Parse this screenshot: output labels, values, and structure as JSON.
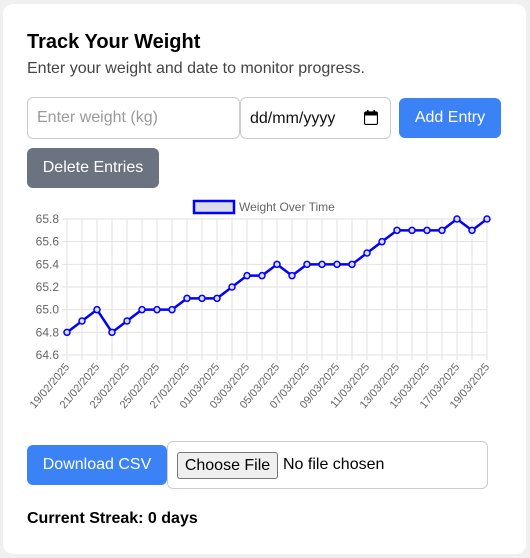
{
  "header": {
    "title": "Track Your Weight",
    "subtitle": "Enter your weight and date to monitor progress."
  },
  "form": {
    "weight_placeholder": "Enter weight (kg)",
    "date_placeholder": "dd/mm/yyyy",
    "add_label": "Add Entry",
    "delete_label": "Delete Entries"
  },
  "chart_data": {
    "type": "line",
    "legend": "Weight Over Time",
    "legend_position": "top",
    "grid": true,
    "ylim": [
      64.6,
      65.8
    ],
    "yticks": [
      "64.6",
      "64.8",
      "65.0",
      "65.2",
      "65.4",
      "65.6",
      "65.8"
    ],
    "x": [
      "19/02/2025",
      "20/02/2025",
      "21/02/2025",
      "22/02/2025",
      "23/02/2025",
      "24/02/2025",
      "25/02/2025",
      "26/02/2025",
      "27/02/2025",
      "28/02/2025",
      "01/03/2025",
      "02/03/2025",
      "03/03/2025",
      "04/03/2025",
      "05/03/2025",
      "06/03/2025",
      "07/03/2025",
      "08/03/2025",
      "09/03/2025",
      "10/03/2025",
      "11/03/2025",
      "12/03/2025",
      "13/03/2025",
      "14/03/2025",
      "15/03/2025",
      "16/03/2025",
      "17/03/2025",
      "18/03/2025",
      "19/03/2025"
    ],
    "xticks": [
      "19/02/2025",
      "21/02/2025",
      "23/02/2025",
      "25/02/2025",
      "27/02/2025",
      "01/03/2025",
      "03/03/2025",
      "05/03/2025",
      "07/03/2025",
      "09/03/2025",
      "11/03/2025",
      "13/03/2025",
      "15/03/2025",
      "17/03/2025",
      "19/03/2025"
    ],
    "series": [
      {
        "name": "Weight Over Time",
        "color": "#0000ff",
        "values": [
          64.8,
          64.9,
          65.0,
          64.8,
          64.9,
          65.0,
          65.0,
          65.0,
          65.1,
          65.1,
          65.1,
          65.2,
          65.3,
          65.3,
          65.4,
          65.3,
          65.4,
          65.4,
          65.4,
          65.4,
          65.5,
          65.6,
          65.7,
          65.7,
          65.7,
          65.7,
          65.8,
          65.7,
          65.8
        ]
      }
    ]
  },
  "actions": {
    "download_label": "Download CSV",
    "choose_file_label": "Choose File",
    "file_status": "No file chosen"
  },
  "streak": {
    "text": "Current Streak: 0 days"
  },
  "colors": {
    "primary": "#3b82f6",
    "secondary": "#6b7280",
    "line": "#0000ff"
  }
}
